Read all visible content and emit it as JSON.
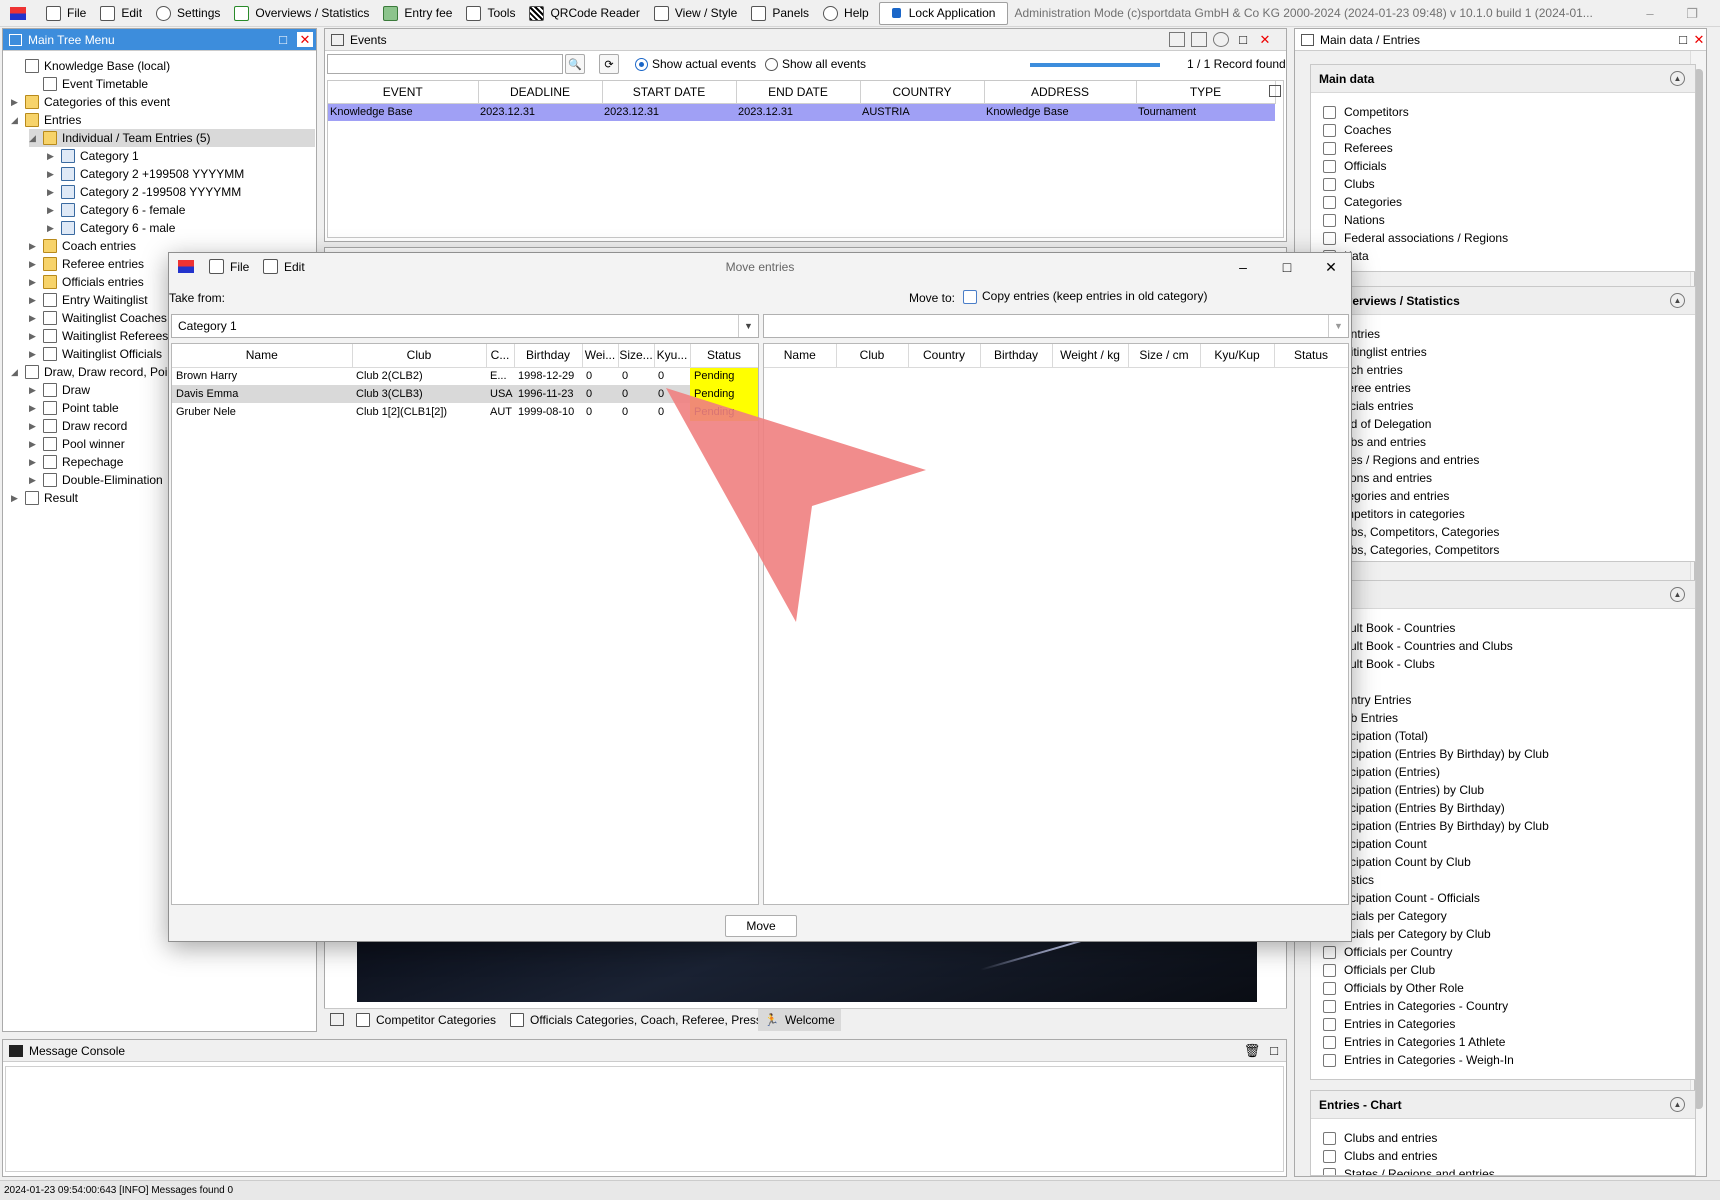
{
  "menubar": {
    "items": [
      "File",
      "Edit",
      "Settings",
      "Overviews / Statistics",
      "Entry fee",
      "Tools",
      "QRCode Reader",
      "View / Style",
      "Panels",
      "Help"
    ],
    "lock_label": "Lock Application",
    "status_text": "Administration Mode (c)sportdata GmbH & Co KG 2000-2024 (2024-01-23 09:48)  v 10.1.0 build 1 (2024-01..."
  },
  "tree": {
    "title": "Main Tree Menu",
    "items": [
      {
        "label": "Knowledge Base (local)"
      },
      {
        "label": "Event Timetable"
      },
      {
        "label": "Categories of this event"
      },
      {
        "label": "Entries"
      },
      {
        "label": "Individual / Team Entries (5)"
      },
      {
        "label": "Category 1"
      },
      {
        "label": "Category 2 +199508 YYYYMM"
      },
      {
        "label": "Category 2 -199508 YYYYMM"
      },
      {
        "label": "Category 6 - female"
      },
      {
        "label": "Category 6 - male"
      },
      {
        "label": "Coach entries"
      },
      {
        "label": "Referee entries"
      },
      {
        "label": "Officials entries"
      },
      {
        "label": "Entry Waitinglist"
      },
      {
        "label": "Waitinglist Coaches"
      },
      {
        "label": "Waitinglist Referees"
      },
      {
        "label": "Waitinglist Officials"
      },
      {
        "label": "Draw, Draw record, Poi"
      },
      {
        "label": "Draw"
      },
      {
        "label": "Point table"
      },
      {
        "label": "Draw record"
      },
      {
        "label": "Pool winner"
      },
      {
        "label": "Repechage"
      },
      {
        "label": "Double-Elimination"
      },
      {
        "label": "Result"
      }
    ]
  },
  "events": {
    "title": "Events",
    "show_actual": "Show actual events",
    "show_all": "Show all events",
    "record_found": "1 / 1 Record found",
    "columns": [
      "EVENT",
      "DEADLINE",
      "START DATE",
      "END DATE",
      "COUNTRY",
      "ADDRESS",
      "TYPE"
    ],
    "rows": [
      [
        "Knowledge Base",
        "2023.12.31",
        "2023.12.31",
        "2023.12.31",
        "AUSTRIA",
        "Knowledge Base",
        "Tournament"
      ]
    ]
  },
  "right_panel": {
    "title": "Main data / Entries",
    "sections": [
      {
        "title": "Main data",
        "items": [
          "Competitors",
          "Coaches",
          "Referees",
          "Officials",
          "Clubs",
          "Categories",
          "Nations",
          "Federal associations / Regions",
          "Kata"
        ]
      },
      {
        "title": "s - Overviews / Statistics",
        "items": [
          "entries",
          "aitinglist entries",
          "ach entries",
          "feree entries",
          "ficials entries",
          "ad of Delegation",
          "ubs and entries",
          "ites / Regions and entries",
          "tions and entries",
          "tegories and entries",
          "mpetitors in categories",
          "ubs, Competitors, Categories",
          "ubs, Categories, Competitors"
        ]
      },
      {
        "title": "ts",
        "items": [
          "sult Book - Countries",
          "sult Book - Countries and Clubs",
          "sult Book - Clubs",
          "",
          "untry Entries",
          "ub Entries",
          "ticipation (Total)",
          "ticipation (Entries By Birthday) by Club",
          "ticipation (Entries)",
          "ticipation (Entries) by Club",
          "ticipation (Entries By Birthday)",
          "ticipation (Entries By Birthday) by Club",
          "ticipation Count",
          "ticipation Count by Club",
          "tistics",
          "ticipation Count - Officials",
          "ficials per Category",
          "ficials per Category by Club",
          "Officials per Country",
          "Officials per Club",
          "Officials by Other Role",
          "Entries in Categories - Country",
          "Entries in Categories",
          "Entries in Categories 1 Athlete",
          "Entries in Categories - Weigh-In"
        ]
      },
      {
        "title": "Entries - Chart",
        "items": [
          "Clubs and entries",
          "Clubs and entries",
          "States / Regions and entries"
        ]
      }
    ]
  },
  "modal": {
    "title": "Move entries",
    "menu": [
      "File",
      "Edit"
    ],
    "take_from_label": "Take from:",
    "move_to_label": "Move to:",
    "copy_label": "Copy entries (keep entries in old category)",
    "source_value": "Category 1",
    "target_value": "",
    "source_columns": [
      "Name",
      "Club",
      "C...",
      "Birthday",
      "Wei...",
      "Size...",
      "Kyu...",
      "Status"
    ],
    "source_rows": [
      [
        "Brown Harry",
        "Club 2(CLB2)",
        "E...",
        "1998-12-29",
        "0",
        "0",
        "0",
        "Pending"
      ],
      [
        "Davis Emma",
        "Club 3(CLB3)",
        "USA",
        "1996-11-23",
        "0",
        "0",
        "0",
        "Pending"
      ],
      [
        "Gruber Nele",
        "Club 1[2](CLB1[2])",
        "AUT",
        "1999-08-10",
        "0",
        "0",
        "0",
        "Pending"
      ]
    ],
    "target_columns": [
      "Name",
      "Club",
      "Country",
      "Birthday",
      "Weight / kg",
      "Size / cm",
      "Kyu/Kup",
      "Status"
    ],
    "move_button": "Move"
  },
  "bottom_tabs": [
    "Competitor Categories",
    "Officials Categories, Coach, Referee, Press",
    "Welcome"
  ],
  "console": {
    "title": "Message Console",
    "status": "2024-01-23 09:54:00:643 [INFO] Messages found 0"
  },
  "colors": {
    "accent": "#3d8ddc",
    "selected_row": "#a0a0f5",
    "pending": "#ffff00",
    "arrow": "#f08080"
  }
}
